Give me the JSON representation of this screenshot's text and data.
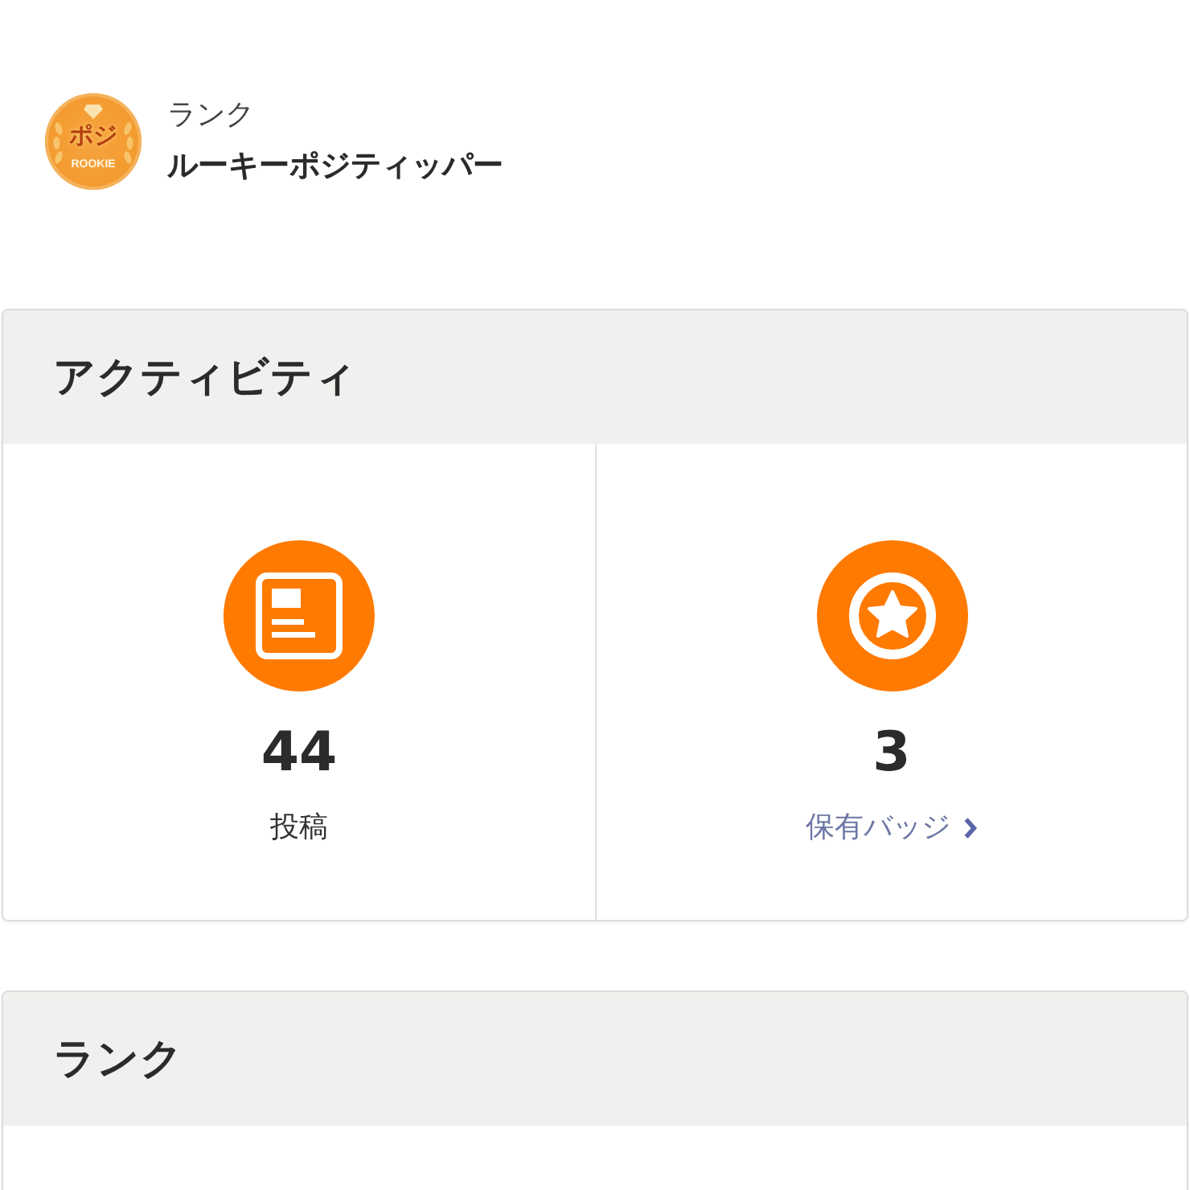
{
  "profile": {
    "badge": {
      "title": "ポジ",
      "label": "ROOKIE"
    },
    "rank_label": "ランク",
    "rank_name": "ルーキーポジティッパー"
  },
  "activity": {
    "title": "アクティビティ",
    "stats": [
      {
        "kind": "posts",
        "value": "44",
        "label": "投稿",
        "link": false
      },
      {
        "kind": "badges",
        "value": "3",
        "label": "保有バッジ",
        "link": true
      }
    ]
  },
  "rank_section": {
    "title": "ランク"
  }
}
